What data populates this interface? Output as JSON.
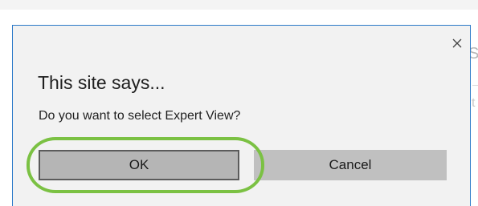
{
  "dialog": {
    "close_icon": "close-icon",
    "title": "This site says...",
    "message": "Do you want to select Expert View?",
    "ok_label": "OK",
    "cancel_label": "Cancel"
  },
  "background": {
    "peek_text_1": "S",
    "peek_text_2": "t"
  },
  "colors": {
    "dialog_border": "#2b79c8",
    "highlight": "#7bc143",
    "button_bg": "#bcbcbc"
  }
}
